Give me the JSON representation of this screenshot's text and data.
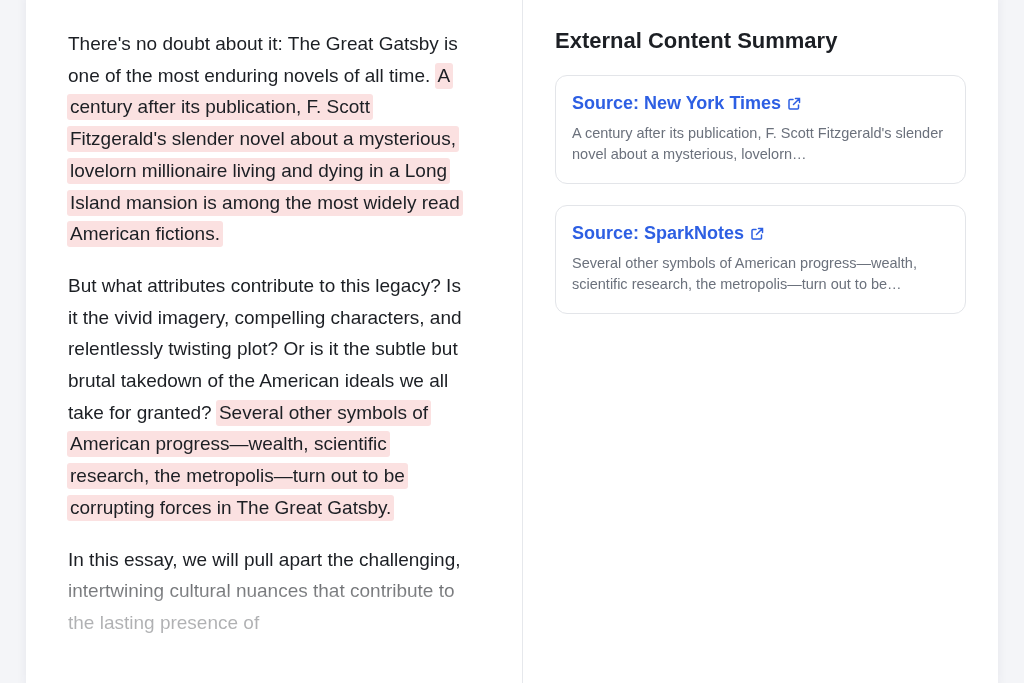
{
  "essay": {
    "paragraphs": [
      {
        "segments": [
          {
            "text": "There's no doubt about it: The Great Gatsby is one of the most enduring novels of all time.",
            "highlighted": false
          },
          {
            "text": "A century after its publication, F. Scott Fitzgerald's slender novel about a mysterious, lovelorn millionaire living and dying in a Long Island mansion is among the most widely read American fictions.",
            "highlighted": true
          }
        ],
        "faded": false
      },
      {
        "segments": [
          {
            "text": "But what attributes contribute to this legacy? Is it the vivid imagery, compelling characters, and relentlessly twisting plot? Or is it the subtle but brutal takedown of the American ideals we all take for granted?",
            "highlighted": false
          },
          {
            "text": "Several other symbols of American progress—wealth, scientific research, the metropolis—turn out to be corrupting forces in The Great Gatsby.",
            "highlighted": true
          }
        ],
        "faded": false
      },
      {
        "segments": [
          {
            "text": "In this essay, we will pull apart the challenging, intertwining cultural nuances that contribute to the lasting presence of",
            "highlighted": false
          }
        ],
        "faded": true
      }
    ]
  },
  "summary": {
    "title": "External Content Summary",
    "sources": [
      {
        "label": "Source: New York Times",
        "excerpt": "A century after its publication, F. Scott Fitzgerald's slender novel about a mysterious, lovelorn…"
      },
      {
        "label": "Source: SparkNotes",
        "excerpt": "Several other symbols of American progress—wealth, scientific research, the metropolis—turn out to be…"
      }
    ]
  }
}
